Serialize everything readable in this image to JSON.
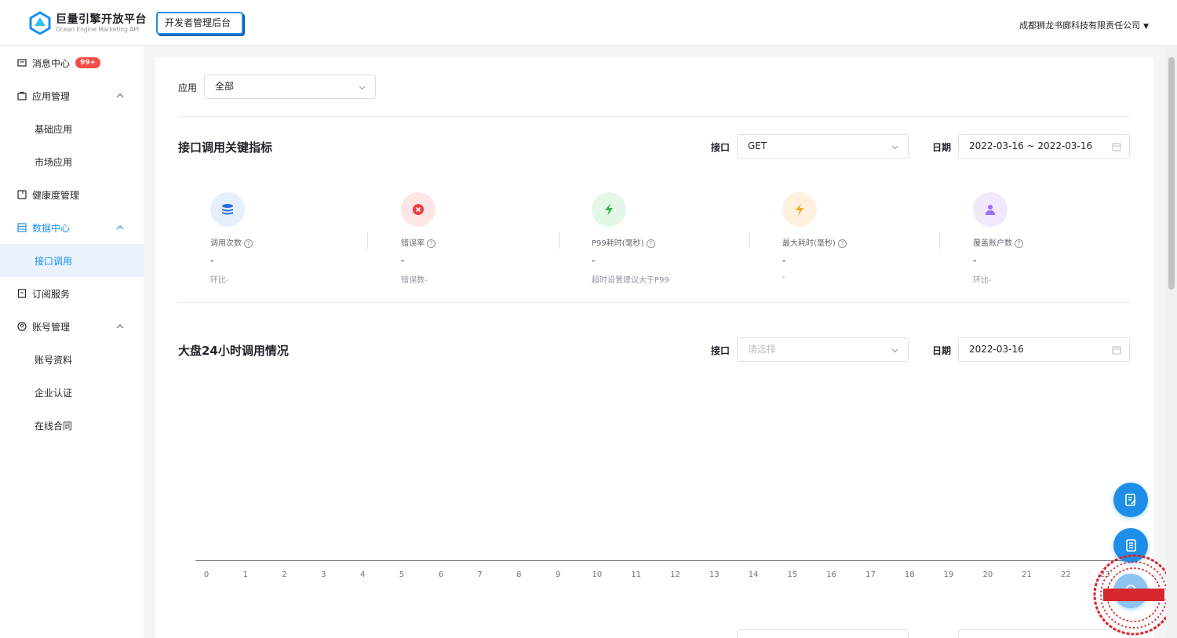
{
  "header": {
    "brand_title": "巨量引擎开放平台",
    "brand_sub": "Ocean Engine Marketing API",
    "dev_badge": "开发者管理后台",
    "company": "成都狮龙书廊科技有限责任公司"
  },
  "sidebar": {
    "items": [
      {
        "label": "消息中心",
        "badge": "99+"
      },
      {
        "label": "应用管理"
      },
      {
        "label": "基础应用"
      },
      {
        "label": "市场应用"
      },
      {
        "label": "健康度管理"
      },
      {
        "label": "数据中心"
      },
      {
        "label": "接口调用"
      },
      {
        "label": "订阅服务"
      },
      {
        "label": "账号管理"
      },
      {
        "label": "账号资料"
      },
      {
        "label": "企业认证"
      },
      {
        "label": "在线合同"
      }
    ]
  },
  "filter": {
    "app_label": "应用",
    "app_value": "全部"
  },
  "kpi": {
    "title": "接口调用关键指标",
    "api_label": "接口",
    "api_value": "GET",
    "date_label": "日期",
    "date_value": "2022-03-16 ~ 2022-03-16",
    "metrics": [
      {
        "name": "调用次数",
        "value": "-",
        "sub": "环比-"
      },
      {
        "name": "错误率",
        "value": "-",
        "sub": "错误数-"
      },
      {
        "name": "P99耗时(毫秒)",
        "value": "-",
        "sub": "超时设置建议大于P99"
      },
      {
        "name": "最大耗时(毫秒)",
        "value": "-",
        "sub": "-"
      },
      {
        "name": "覆盖账户数",
        "value": "-",
        "sub": "环比-"
      }
    ]
  },
  "chart_section": {
    "title": "大盘24小时调用情况",
    "api_label": "接口",
    "api_placeholder": "请选择",
    "date_label": "日期",
    "date_value": "2022-03-16"
  },
  "chart_data": {
    "type": "line",
    "x": [
      "0",
      "1",
      "2",
      "3",
      "4",
      "5",
      "6",
      "7",
      "8",
      "9",
      "10",
      "11",
      "12",
      "13",
      "14",
      "15",
      "16",
      "17",
      "18",
      "19",
      "20",
      "21",
      "22",
      "23"
    ],
    "series": [],
    "title": "",
    "xlabel": "",
    "ylabel": ""
  },
  "colors": {
    "accent": "#1d8fe8",
    "badge_red": "#f54a45"
  }
}
